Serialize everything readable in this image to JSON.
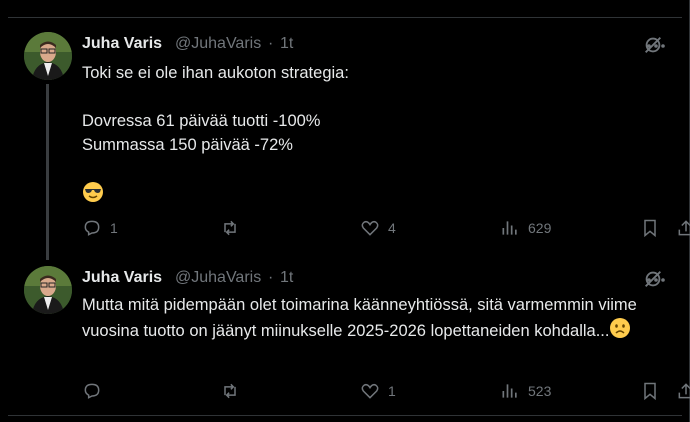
{
  "tweets": [
    {
      "name": "Juha Varis",
      "handle": "@JuhaVaris",
      "dot": "·",
      "time": "1t",
      "text": "Toki se ei ole ihan aukoton strategia:\n\nDovressa 61 päivää tuotti -100%\nSummassa 150 päivää -72%\n\n",
      "emoji": "sunglasses",
      "replies": "1",
      "reposts": "",
      "likes": "4",
      "views": "629"
    },
    {
      "name": "Juha Varis",
      "handle": "@JuhaVaris",
      "dot": "·",
      "time": "1t",
      "text": "Mutta mitä pidempään olet toimarina käänneyhtiössä, sitä varmemmin viime vuosina tuotto on jäänyt miinukselle 2025-2026 lopettaneiden kohdalla...",
      "emoji": "frowning",
      "replies": "",
      "reposts": "",
      "likes": "1",
      "views": "523"
    }
  ]
}
